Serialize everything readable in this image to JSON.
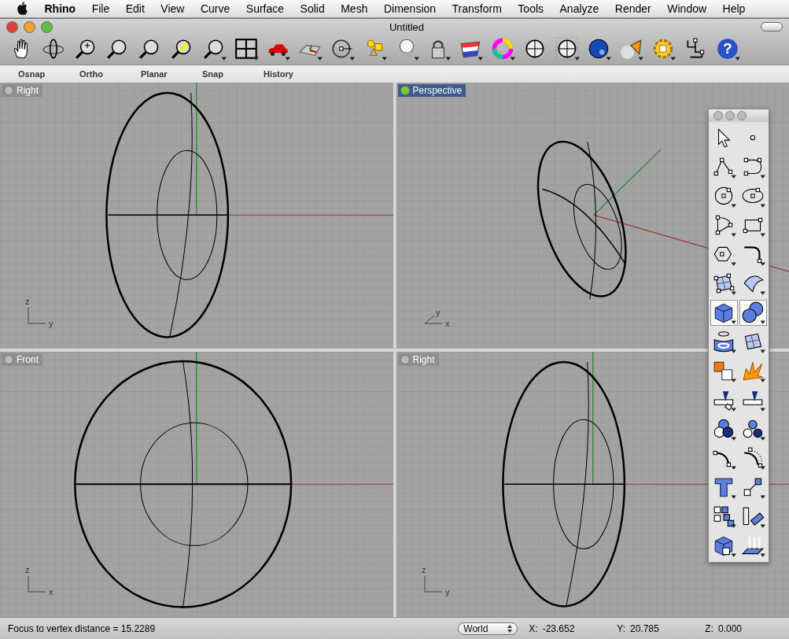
{
  "menu_bar": {
    "app": "Rhino",
    "items": [
      "File",
      "Edit",
      "View",
      "Curve",
      "Surface",
      "Solid",
      "Mesh",
      "Dimension",
      "Transform",
      "Tools",
      "Analyze",
      "Render",
      "Window",
      "Help"
    ]
  },
  "window": {
    "title": "Untitled"
  },
  "toolbar": {
    "help_glyph": "?"
  },
  "status_toggles": [
    "Osnap",
    "Ortho",
    "Planar",
    "Snap",
    "History"
  ],
  "viewports": [
    {
      "title": "Right",
      "kind": "right",
      "selected": false,
      "axes": [
        {
          "kind": "vertical",
          "label": "z"
        },
        {
          "kind": "horizontal",
          "label": "y"
        }
      ]
    },
    {
      "title": "Perspective",
      "kind": "perspective",
      "selected": true,
      "axes": [
        {
          "kind": "diagonal",
          "label": "y"
        },
        {
          "kind": "horizontal",
          "label": "x"
        }
      ]
    },
    {
      "title": "Front",
      "kind": "front",
      "selected": false,
      "axes": [
        {
          "kind": "vertical",
          "label": "z"
        },
        {
          "kind": "horizontal",
          "label": "x"
        }
      ]
    },
    {
      "title": "Right",
      "kind": "right",
      "selected": false,
      "axes": [
        {
          "kind": "vertical",
          "label": "z"
        },
        {
          "kind": "horizontal",
          "label": "y"
        }
      ]
    }
  ],
  "palette": {
    "buttons": [
      {
        "kind": "pointer",
        "selected": false
      },
      {
        "kind": "point",
        "selected": false
      },
      {
        "kind": "polyline",
        "selected": false
      },
      {
        "kind": "curve",
        "selected": false
      },
      {
        "kind": "circle",
        "selected": false
      },
      {
        "kind": "ellipse",
        "selected": false
      },
      {
        "kind": "arc",
        "selected": false
      },
      {
        "kind": "rectangle",
        "selected": false
      },
      {
        "kind": "polygon",
        "selected": false
      },
      {
        "kind": "fillet",
        "selected": false
      },
      {
        "kind": "surface-points",
        "selected": false
      },
      {
        "kind": "surface",
        "selected": false
      },
      {
        "kind": "box",
        "selected": true
      },
      {
        "kind": "spheres",
        "selected": true
      },
      {
        "kind": "extrude",
        "selected": false
      },
      {
        "kind": "surface-grid",
        "selected": false
      },
      {
        "kind": "puzzle",
        "selected": false
      },
      {
        "kind": "explosion",
        "selected": false
      },
      {
        "kind": "trim",
        "selected": false
      },
      {
        "kind": "split",
        "selected": false
      },
      {
        "kind": "boolean",
        "selected": false
      },
      {
        "kind": "dots",
        "selected": false
      },
      {
        "kind": "curve-end",
        "selected": false
      },
      {
        "kind": "curve-extend",
        "selected": false
      },
      {
        "kind": "text",
        "selected": false
      },
      {
        "kind": "move",
        "selected": false
      },
      {
        "kind": "array",
        "selected": false
      },
      {
        "kind": "scale",
        "selected": false
      },
      {
        "kind": "solid-box",
        "selected": false
      },
      {
        "kind": "arrows",
        "selected": false
      }
    ]
  },
  "status_bar": {
    "message": "Focus to vertex distance = 15.2289",
    "coordinate_system": "World",
    "coordinates": [
      {
        "label": "X:",
        "value": "-23.652"
      },
      {
        "label": "Y:",
        "value": "20.785"
      },
      {
        "label": "Z:",
        "value": "0.000"
      }
    ]
  }
}
